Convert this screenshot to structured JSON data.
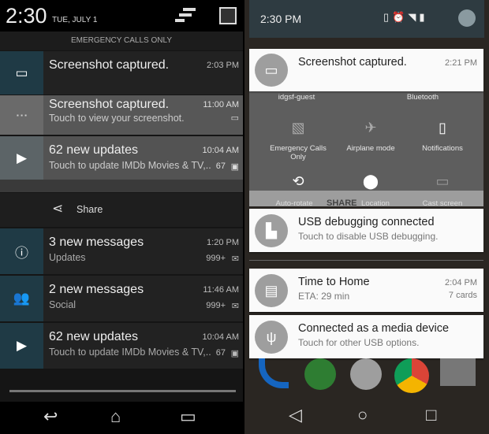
{
  "left": {
    "status": {
      "time": "2:30",
      "date": "TUE, JULY 1"
    },
    "emergency": "EMERGENCY CALLS ONLY",
    "notifications": [
      {
        "title": "Screenshot captured.",
        "time": "2:03 PM",
        "icon": "image-icon"
      },
      {
        "title": "Screenshot captured.",
        "subtitle": "Touch to view your screenshot.",
        "time": "11:00 AM",
        "icon": "screenshot-thumbnail"
      },
      {
        "title": "62 new updates",
        "subtitle": "Touch to update IMDb Movies & TV,..",
        "time": "10:04 AM",
        "count": "67",
        "icon": "play-store-icon"
      },
      {
        "title": "3 new messages",
        "subtitle": "Updates",
        "time": "1:20 PM",
        "count": "999+",
        "icon": "info-icon"
      },
      {
        "title": "2 new messages",
        "subtitle": "Social",
        "time": "11:46 AM",
        "count": "999+",
        "icon": "people-icon"
      },
      {
        "title": "62 new updates",
        "subtitle": "Touch to update IMDb Movies & TV,..",
        "time": "10:04 AM",
        "count": "67",
        "icon": "play-store-icon"
      }
    ],
    "share_label": "Share"
  },
  "right": {
    "status": {
      "time": "2:30 PM"
    },
    "quick_settings": {
      "wifi": "idgsf-guest",
      "bluetooth": "Bluetooth",
      "sim": "Emergency Calls Only",
      "airplane": "Airplane mode",
      "notifications": "Notifications",
      "rotate": "Auto-rotate",
      "location": "Location",
      "cast": "Cast screen",
      "share": "SHARE"
    },
    "notifications": [
      {
        "title": "Screenshot captured.",
        "time": "2:21 PM"
      },
      {
        "title": "USB debugging connected",
        "subtitle": "Touch to disable USB debugging."
      },
      {
        "title": "Time to Home",
        "subtitle": "ETA: 29 min",
        "time": "2:04 PM",
        "extra": "7 cards"
      },
      {
        "title": "Connected as a media device",
        "subtitle": "Touch for other USB options."
      }
    ]
  }
}
